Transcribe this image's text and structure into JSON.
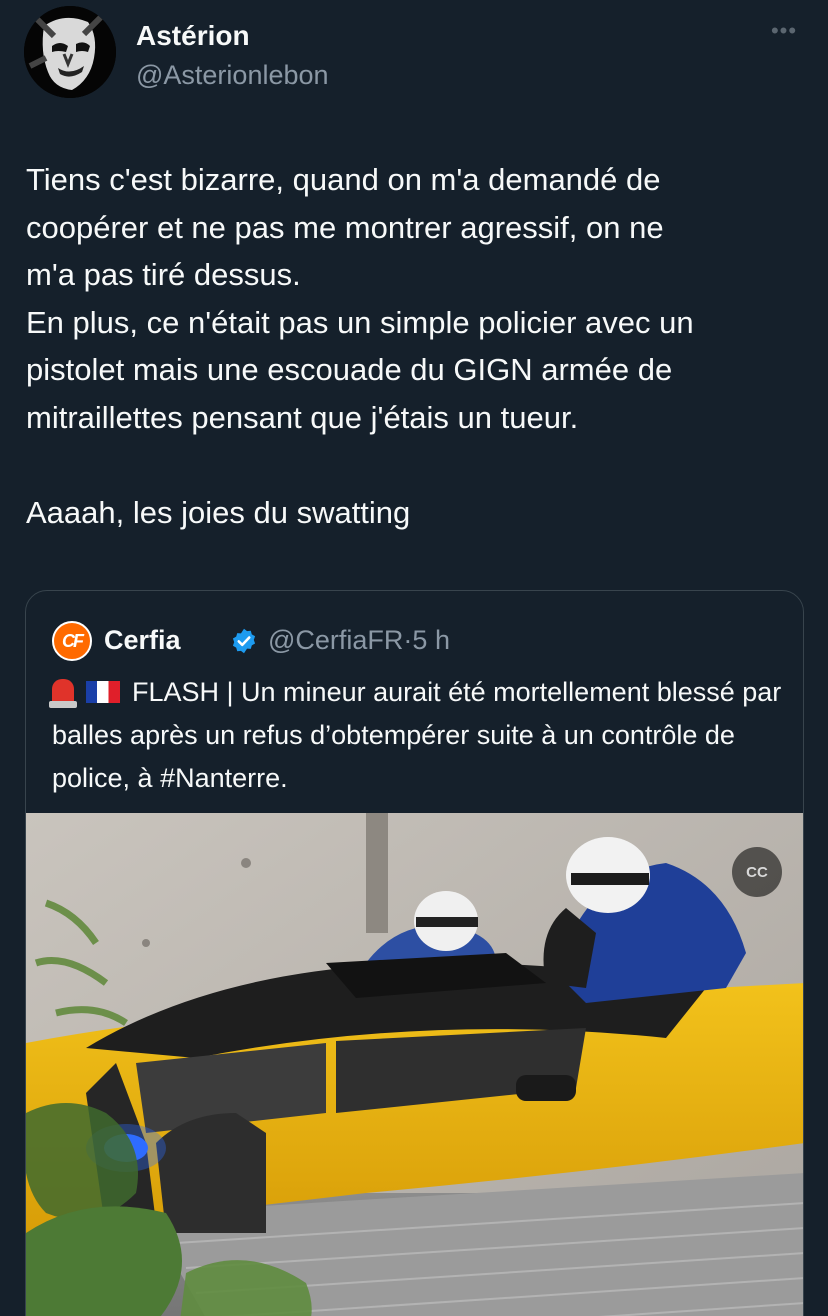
{
  "author": {
    "name": "Astérion",
    "handle": "@Asterionlebon",
    "avatar_icon": "avatar-image"
  },
  "more_label": "•••",
  "tweet": {
    "text": "Tiens c'est bizarre, quand on m'a demandé de\ncoopérer et ne pas me montrer agressif, on ne\nm'a pas tiré dessus.\nEn plus, ce n'était pas un simple policier avec un\npistolet mais une escouade du GIGN armée de\nmitraillettes pensant que j'étais un tueur.\n\nAaaah, les joies du swatting"
  },
  "quoted": {
    "avatar_label": "CF",
    "name": "Cerfia",
    "handle": "@CerfiaFR",
    "separator": "·",
    "time": "5 h",
    "text": "FLASH | Un mineur aurait été mortellement blessé par balles après un refus d’obtempérer suite à un contrôle de police, à #Nanterre.",
    "media_badge": "CC"
  },
  "colors": {
    "background": "#15202b",
    "text": "#f7f9f9",
    "muted": "#8b98a5",
    "verified": "#1d9bf0",
    "border": "#38444d"
  }
}
